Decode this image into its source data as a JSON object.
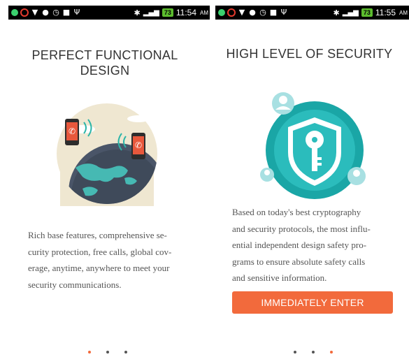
{
  "screens": [
    {
      "status": {
        "time": "11:54",
        "ampm": "AM",
        "battery": "73"
      },
      "title_lines": [
        "PERFECT FUNCTIONAL",
        "DESIGN"
      ],
      "body_lines": [
        "Rich base features, comprehensive se-",
        "curity protection, free calls, global cov-",
        "erage, anytime, anywhere to meet your",
        "security communications."
      ],
      "illustration": "globe-phones-icon",
      "page_indicator": {
        "count": 3,
        "active_index": 0
      }
    },
    {
      "status": {
        "time": "11:55",
        "ampm": "AM",
        "battery": "73"
      },
      "title_lines": [
        "HIGH LEVEL OF SECURITY"
      ],
      "body_lines": [
        "Based on today's best cryptography",
        "and security protocols, the most influ-",
        "ential independent design safety pro-",
        "grams to ensure absolute safety calls",
        "and sensitive information."
      ],
      "button_label": "IMMEDIATELY ENTER",
      "illustration": "shield-key-icon",
      "page_indicator": {
        "count": 3,
        "active_index": 2
      }
    }
  ],
  "colors": {
    "accent": "#f26a3c",
    "teal": "#1aa6a6",
    "status_bar": "#000000",
    "battery": "#5cbc2e"
  }
}
